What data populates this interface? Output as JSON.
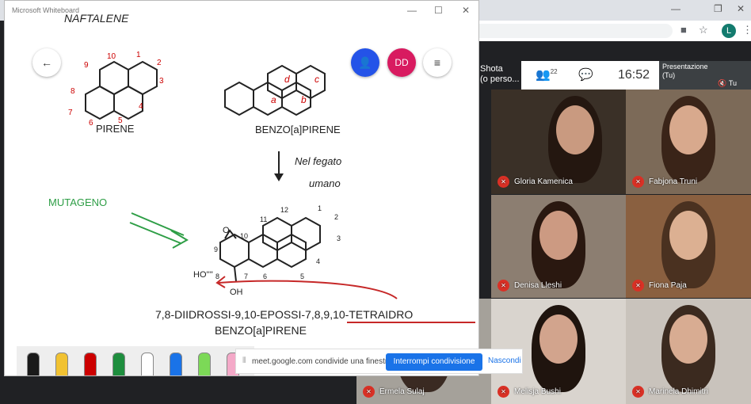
{
  "whiteboard": {
    "title": "Microsoft Whiteboard",
    "controls": {
      "minimize": "—",
      "maximize": "☐",
      "close": "✕"
    },
    "back_icon": "back-arrow-icon",
    "user_initials": "DD",
    "cropped_heading": "NAFTALENE",
    "pyrene": {
      "label": "PIRENE",
      "numbers": [
        "10",
        "1",
        "2",
        "3",
        "4",
        "5",
        "6",
        "7",
        "8",
        "9"
      ]
    },
    "benzopyrene": {
      "label": "BENZO[a]PIRENE",
      "rings": [
        "a",
        "b",
        "c",
        "d"
      ]
    },
    "metabolism_note": [
      "Nel fegato",
      "umano"
    ],
    "mutagen_label": "MUTAGENO",
    "epoxide": {
      "numbers": [
        "10",
        "11",
        "12",
        "1",
        "2",
        "3",
        "4",
        "5",
        "6",
        "7",
        "8",
        "9"
      ],
      "oh_labels": [
        "HO''''",
        "OH"
      ],
      "oxygen": "O"
    },
    "product_name_line1": "7,8-DIIDROSSI-9,10-EPOSSI-7,8,9,10-TETRAIDRO",
    "product_name_line2": "BENZO[a]PIRENE",
    "pen_colors": [
      "#1a1a1a",
      "#f1c232",
      "#cc0000",
      "#1e8e3e",
      "#ffffff",
      "#1a73e8",
      "#7cd957",
      "#f4a9c8"
    ]
  },
  "share_banner": {
    "message": "meet.google.com condivide una finestra.",
    "stop_label": "Interrompi condivisione",
    "hide_label": "Nascondi"
  },
  "meet": {
    "presenter_text": "Shota\n(o perso...",
    "participants_count": "22",
    "time": "16:52",
    "presentation_tile": {
      "title": "Presentazione",
      "subtitle": "(Tu)",
      "you": "Tu"
    },
    "participants": [
      {
        "name": "Gloria Kamenica",
        "bg": "#3a3027",
        "skin": "#c99a80",
        "hair": "#241710"
      },
      {
        "name": "Fabjona Truni",
        "bg": "#7c6a58",
        "skin": "#d8a98d",
        "hair": "#3a2418"
      },
      {
        "name": "Denisa Lleshi",
        "bg": "#8c7e71",
        "skin": "#cc9a82",
        "hair": "#2a1810"
      },
      {
        "name": "Fiona Paja",
        "bg": "#8a6040",
        "skin": "#dcb092",
        "hair": "#4a3120"
      },
      {
        "name": "Ermela Sulaj",
        "bg": "#a5a19a",
        "skin": "#caa090",
        "hair": "#3a2a22"
      },
      {
        "name": "Melisja Bushi",
        "bg": "#d9d4ce",
        "skin": "#d2a48d",
        "hair": "#1f140e"
      },
      {
        "name": "Marinela Dhimitri",
        "bg": "#c9c3bc",
        "skin": "#d8ac92",
        "hair": "#3b2a1f"
      }
    ]
  },
  "browser": {
    "profile_initial": "L"
  }
}
